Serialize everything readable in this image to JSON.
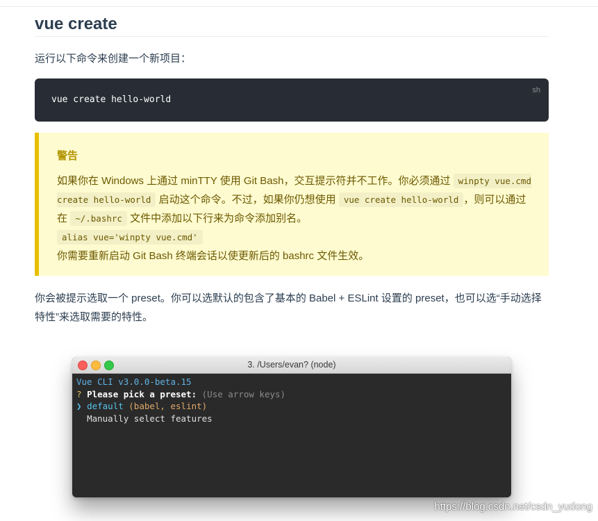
{
  "heading": "vue create",
  "intro": "运行以下命令来创建一个新项目：",
  "code": {
    "text": "vue create hello-world",
    "lang": "sh"
  },
  "warning": {
    "title": "警告",
    "t1": "如果你在 Windows 上通过 minTTY 使用 Git Bash，交互提示符并不工作。你必须通过",
    "c1": "winpty vue.cmd create hello-world",
    "t2": "启动这个命令。不过，如果你仍想使用",
    "c2": "vue create hello-world",
    "t3": "，则可以通过在",
    "c3": "~/.bashrc",
    "t4": "文件中添加以下行来为命令添加别名。",
    "c4": "alias vue='winpty vue.cmd'",
    "t5": "你需要重新启动 Git Bash 终端会话以使更新后的 bashrc 文件生效。"
  },
  "preset_text": "你会被提示选取一个 preset。你可以选默认的包含了基本的 Babel + ESLint 设置的 preset，也可以选“手动选择特性”来选取需要的特性。",
  "terminal": {
    "title": "3. /Users/evan? (node)",
    "line1": "Vue CLI v3.0.0-beta.15",
    "q_mark": "?",
    "q_text": "Please pick a preset:",
    "q_hint": "(Use arrow keys)",
    "pointer": "❯",
    "opt1_name": "default",
    "opt1_args": "(babel, eslint)",
    "opt2": "Manually select features"
  },
  "watermark": "https://blog.csdn.net/csdn_yudong"
}
